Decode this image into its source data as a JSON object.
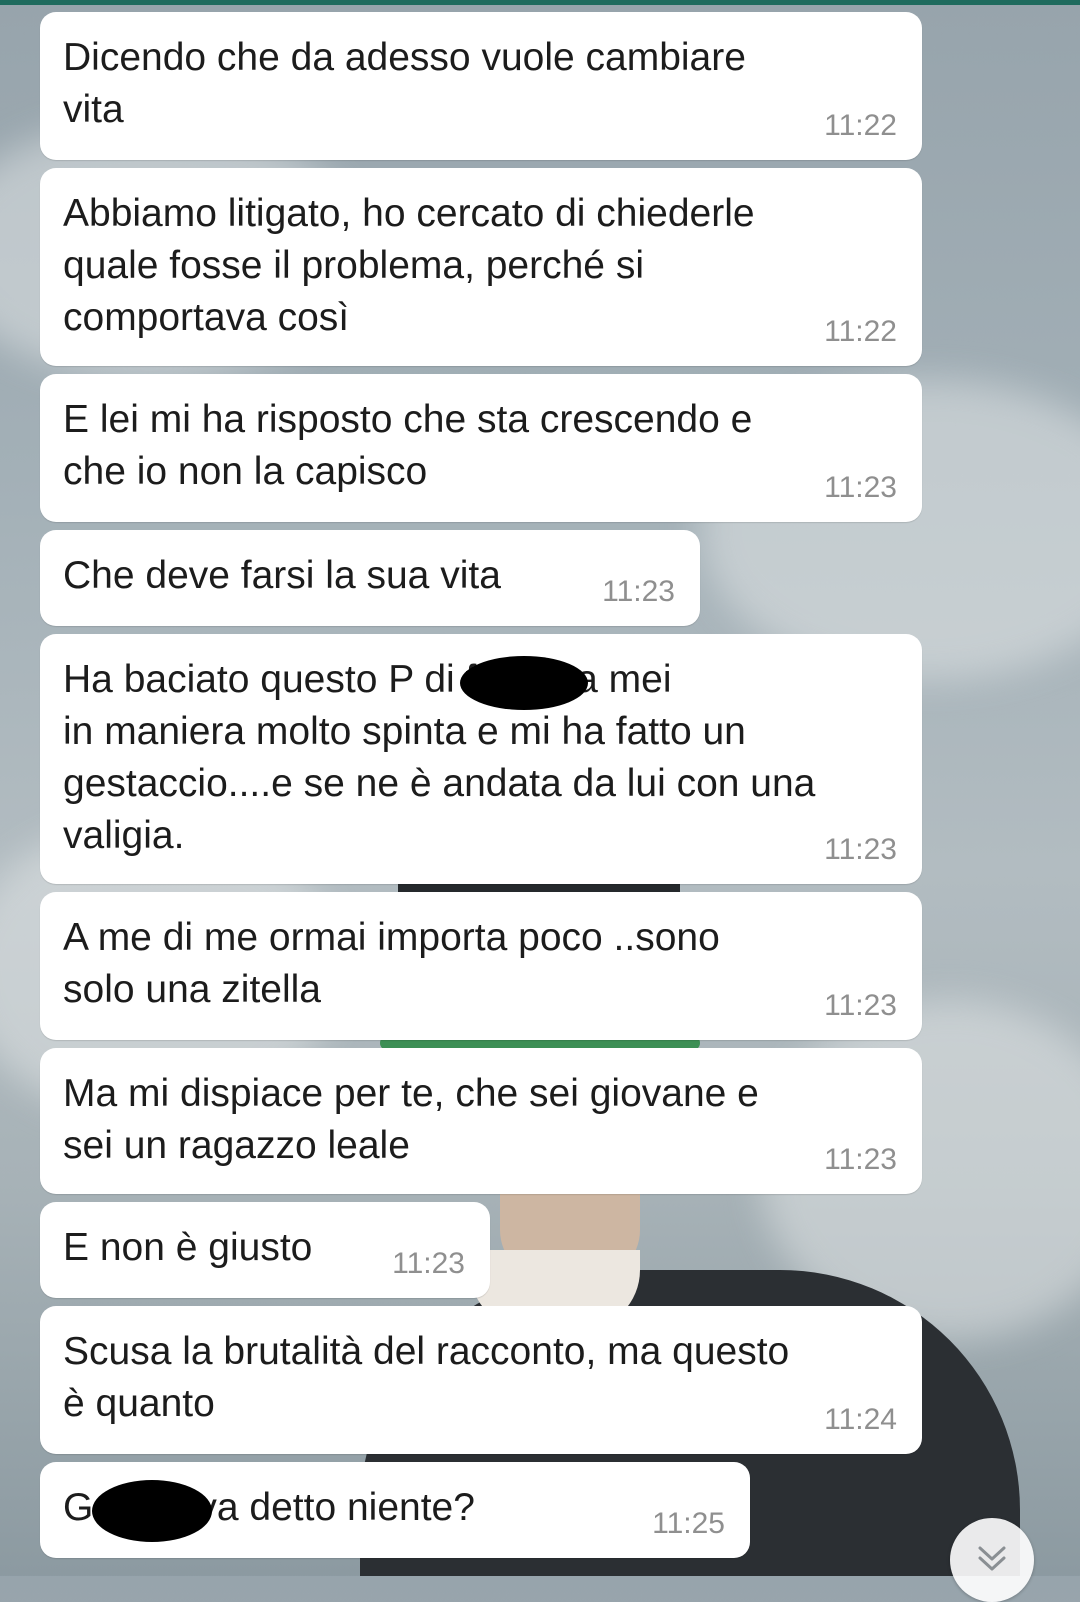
{
  "messages": [
    {
      "text": "Dicendo che da adesso vuole cambiare\nvita",
      "time": "11:22"
    },
    {
      "text": "Abbiamo litigato, ho cercato di chiederle\nquale fosse il problema, perché si\ncomportava così",
      "time": "11:22"
    },
    {
      "text": "E lei mi ha risposto che sta crescendo e\nche io non la capisco",
      "time": "11:23"
    },
    {
      "text": "Che deve farsi la sua vita",
      "time": "11:23"
    },
    {
      "text": "Ha baciato questo P          di fronte a mei\nin maniera molto spinta e mi ha fatto un\ngestaccio....e se ne è andata da lui con una\nvaligia.",
      "time": "11:23"
    },
    {
      "text": "A me di me ormai importa poco ..sono\nsolo una zitella",
      "time": "11:23"
    },
    {
      "text": "Ma mi dispiace per te, che sei giovane e\nsei un ragazzo leale",
      "time": "11:23"
    },
    {
      "text": "E non è giusto",
      "time": "11:23"
    },
    {
      "text": "Scusa la brutalità del racconto, ma questo\nè quanto",
      "time": "11:24"
    },
    {
      "text": "G        ti aveva detto niente?",
      "time": "11:25"
    }
  ],
  "scroll_button": {
    "icon": "double-chevron-down-icon"
  }
}
